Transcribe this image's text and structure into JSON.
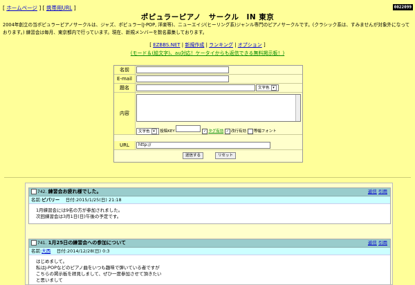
{
  "topnav": {
    "open": "[ ",
    "home": "ホームページ",
    "sep": " ] [ ",
    "mobile": "携帯用URL",
    "close": " ]"
  },
  "counter": "0022099",
  "title": "ポピュラーピアノ　サークル　IN 東京",
  "description": "2004年創立の当ポピュラーピアノサークルは、ジャズ、ポピュラー(J-POP, 洋楽等)、ニューエイジ(ヒーリング系)ジャンル専門のピアノサークルです。(クラシック系は、すみませんが対象外になっております。) 練習会は毎月、東京都内で行っています。現在、新規メンバーを数名募集しております。",
  "nav": {
    "items": [
      "EZBBS.NET",
      "新規作成",
      "ランキング",
      "オプション"
    ],
    "open": "[ ",
    "sep": " | ",
    "close": " ]",
    "mobile_note": "(モード＆(絵文字)、au対応！ケータイからも返信できる無料掲示板！)"
  },
  "form": {
    "name_label": "名前",
    "email_label": "E-mail",
    "subject_label": "題名",
    "body_label": "内容",
    "url_label": "URL",
    "url_value": "http://",
    "color_select": "文字色",
    "key_label": "投稿KEY",
    "tag_label": "タグ有効",
    "newline_label": "改行有効",
    "fixed_font_label": "等幅フォント",
    "submit": "送信する",
    "reset": "リセット"
  },
  "posts": [
    {
      "num": "742.",
      "title": "練習会お疲れ様でした。",
      "reply": "返信",
      "quote": "引用",
      "name_label": "名前:",
      "name": "ピパリー",
      "date_label": "日付:",
      "date": "2015/1/25(日) 21:18",
      "lines": [
        "1月練習会には9名の方が参加されました。",
        "次回練習会は3月1日(日)午後の予定です。"
      ]
    },
    {
      "num": "741.",
      "title": "1月25日の練習会への参加について",
      "reply": "返信",
      "quote": "引用",
      "name_label": "名前:",
      "name": "大西",
      "date_label": "日付:",
      "date": "2014/12/28(日) 0:3",
      "lines": [
        "はじめまして。",
        "私はJ-POPなどのピアノ曲をいつも趣味で弾いている者ですが",
        "こちらの掲示板を拝見しまして、ぜひ一度参加させて頂きたい",
        "と思いまして"
      ]
    }
  ]
}
